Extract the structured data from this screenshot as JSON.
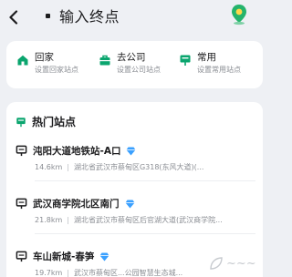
{
  "search": {
    "value": "输入终点"
  },
  "quick": [
    {
      "title": "回家",
      "subtitle": "设置回家站点"
    },
    {
      "title": "去公司",
      "subtitle": "设置公司站点"
    },
    {
      "title": "常用",
      "subtitle": "设置常用站点"
    }
  ],
  "hot": {
    "title": "热门站点",
    "stations": [
      {
        "name": "沌阳大道地铁站-A口",
        "distance": "14.6km",
        "address": "湖北省武汉市蔡甸区G318(东风大道)(..."
      },
      {
        "name": "武汉商学院北区南门",
        "distance": "21.8km",
        "address": "湖北省武汉市蔡甸区后官湖大道(武汉商学院..."
      },
      {
        "name": "车山新城-春笋",
        "distance": "19.7km",
        "address": "武汉市蔡甸区...公园智慧生态城..."
      }
    ]
  },
  "colors": {
    "accent": "#0aa56e",
    "badge": "#3aa0ff",
    "map_icon": "#25b46c"
  }
}
